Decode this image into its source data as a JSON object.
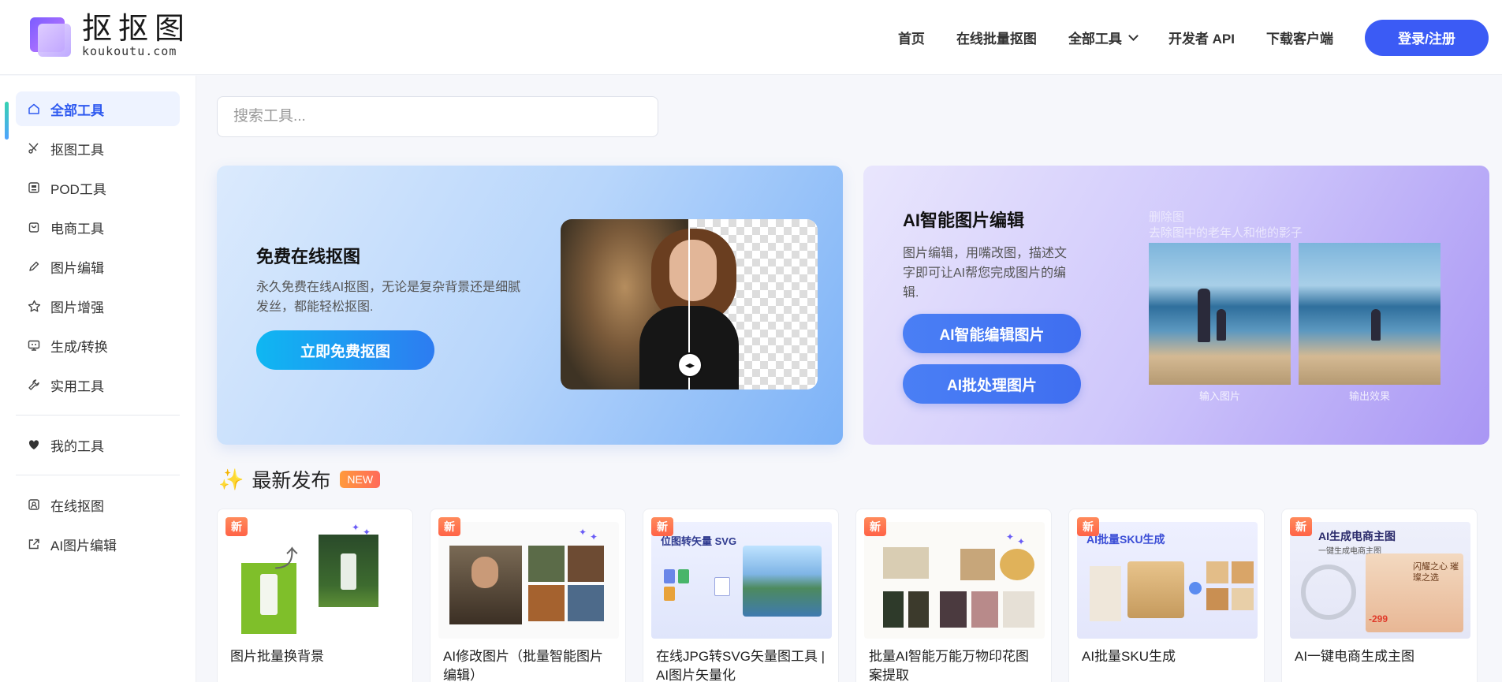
{
  "header": {
    "logo_title": "抠抠图",
    "logo_sub": "koukoutu.com",
    "nav": [
      "首页",
      "在线批量抠图",
      "全部工具",
      "开发者 API",
      "下载客户端"
    ],
    "login_label": "登录/注册"
  },
  "sidebar": {
    "items": [
      {
        "label": "全部工具",
        "icon": "home-icon"
      },
      {
        "label": "抠图工具",
        "icon": "scissors-icon"
      },
      {
        "label": "POD工具",
        "icon": "print-icon"
      },
      {
        "label": "电商工具",
        "icon": "bag-icon"
      },
      {
        "label": "图片编辑",
        "icon": "pencil-icon"
      },
      {
        "label": "图片增强",
        "icon": "star-icon"
      },
      {
        "label": "生成/转换",
        "icon": "monitor-icon"
      },
      {
        "label": "实用工具",
        "icon": "wrench-icon"
      }
    ],
    "my_tools": "我的工具",
    "links": [
      "在线抠图",
      "AI图片编辑"
    ]
  },
  "search": {
    "placeholder": "搜索工具..."
  },
  "banner1": {
    "title": "免费在线抠图",
    "desc": "永久免费在线AI抠图，无论是复杂背景还是细腻发丝，都能轻松抠图.",
    "button": "立即免费抠图"
  },
  "banner2": {
    "title": "AI智能图片编辑",
    "desc": "图片编辑，用嘴改图，描述文字即可让AI帮您完成图片的编辑.",
    "button1": "AI智能编辑图片",
    "button2": "AI批处理图片",
    "tag1": "删除图",
    "tag2": "去除图中的老年人和他的影子",
    "caption_in": "输入图片",
    "caption_out": "输出效果"
  },
  "latest": {
    "title": "最新发布",
    "badge": "NEW"
  },
  "cards": [
    {
      "badge": "新",
      "title": "图片批量换背景"
    },
    {
      "badge": "新",
      "title": "AI修改图片（批量智能图片编辑）"
    },
    {
      "badge": "新",
      "title": "在线JPG转SVG矢量图工具 | AI图片矢量化"
    },
    {
      "badge": "新",
      "title": "批量AI智能万能万物印花图案提取"
    },
    {
      "badge": "新",
      "title": "AI批量SKU生成"
    },
    {
      "badge": "新",
      "title": "AI一键电商生成主图"
    }
  ],
  "card_thumb_text": {
    "c3_title": "位图转矢量 SVG",
    "c5_title": "AI批量SKU生成",
    "c6_title": "AI生成电商主图",
    "c6_sub": "一键生成电商主图",
    "c6_price": "-299",
    "c6_slogan": "闪耀之心 璀璨之选"
  },
  "colors": {
    "primary": "#3b5bf5",
    "accent": "#2f5af0",
    "badge": "#ff6a5a"
  }
}
